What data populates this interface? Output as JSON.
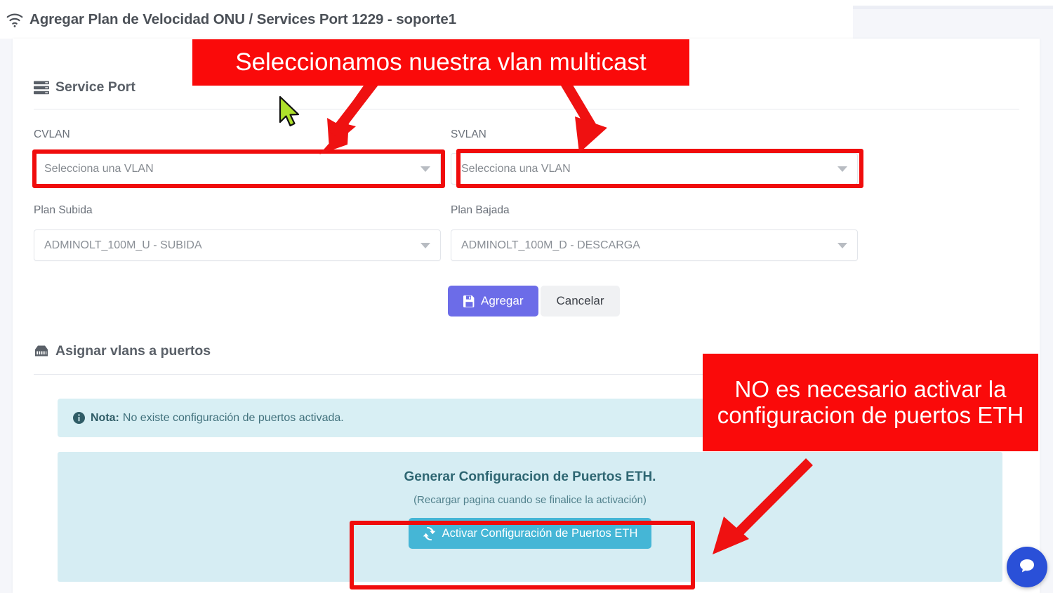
{
  "header": {
    "icon": "wifi-icon",
    "title": "Agregar Plan de Velocidad ONU / Services Port 1229 - soporte1"
  },
  "service_port": {
    "icon": "server-stack-icon",
    "heading": "Service Port",
    "fields": [
      {
        "label": "CVLAN",
        "value": "",
        "placeholder": "Selecciona una VLAN",
        "highlighted": true
      },
      {
        "label": "SVLAN",
        "value": "",
        "placeholder": "Selecciona una VLAN",
        "highlighted": true
      },
      {
        "label": "Plan Subida",
        "value": "ADMINOLT_100M_U - SUBIDA",
        "placeholder": "",
        "highlighted": false
      },
      {
        "label": "Plan Bajada",
        "value": "ADMINOLT_100M_D - DESCARGA",
        "placeholder": "",
        "highlighted": false
      }
    ],
    "submit_label": "Agregar",
    "submit_icon": "save-icon",
    "cancel_label": "Cancelar"
  },
  "ports_section": {
    "icon": "ethernet-port-icon",
    "heading": "Asignar vlans a puertos",
    "note": {
      "icon": "info-circle-icon",
      "strong": "Nota:",
      "text": "No existe configuración de puertos activada."
    },
    "eth_panel": {
      "title": "Generar Configuracion de Puertos ETH.",
      "subtitle": "(Recargar pagina cuando se finalice la activación)",
      "button_label": "Activar Configuración de Puertos ETH",
      "button_icon": "refresh-icon"
    }
  },
  "annotations": [
    {
      "id": "anno-vlan",
      "text": "Seleccionamos nuestra vlan multicast"
    },
    {
      "id": "anno-eth",
      "text": "NO es necesario activar la configuracion de puertos ETH"
    }
  ],
  "chat_widget": {
    "icon": "chat-bubble-icon"
  },
  "colors": {
    "annotation_red": "#fa0a0a",
    "primary_button": "#6c6ce8",
    "eth_button": "#45b6d6",
    "alert_bg": "#d8eff4",
    "panel_bg": "#d6edf3",
    "chat_blue": "#2a50d8",
    "cursor_green": "#aee02b"
  }
}
